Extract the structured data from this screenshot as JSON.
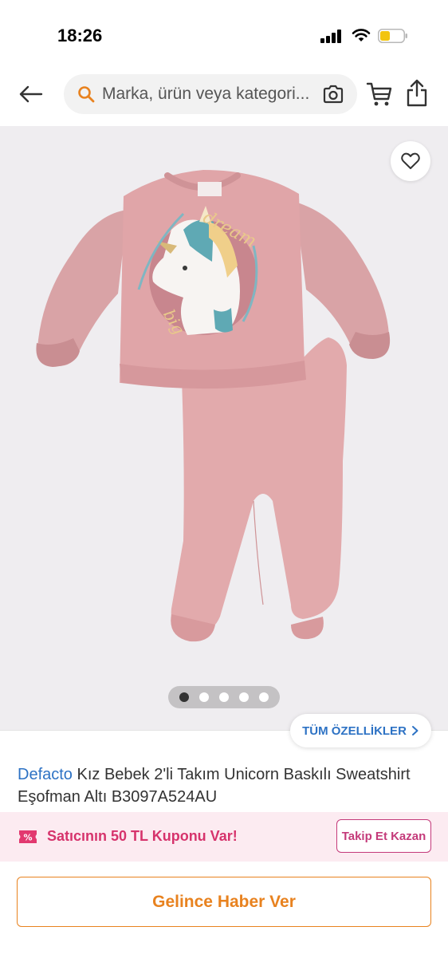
{
  "status_bar": {
    "time": "18:26"
  },
  "search": {
    "placeholder": "Marka, ürün veya kategori..."
  },
  "gallery": {
    "image_count": 5,
    "active_index": 0,
    "print_text_1": "dream",
    "print_text_2": "big"
  },
  "specs_link": {
    "label": "TÜM ÖZELLİKLER"
  },
  "product": {
    "brand": "Defacto",
    "name": " Kız Bebek 2'li Takım Unicorn Baskılı Sweatshirt Eşofman Altı B3097A524AU"
  },
  "coupon": {
    "text": "Satıcının 50 TL Kuponu Var!",
    "follow_label": "Takip Et Kazan"
  },
  "notify": {
    "label": "Gelince Haber Ver"
  },
  "colors": {
    "brand_blue": "#2d72c4",
    "accent_orange": "#e8821f",
    "coupon_pink": "#d6336c",
    "coupon_bg": "#fcebf1",
    "image_bg": "#efedf0",
    "garment_pink": "#dea3a6"
  }
}
